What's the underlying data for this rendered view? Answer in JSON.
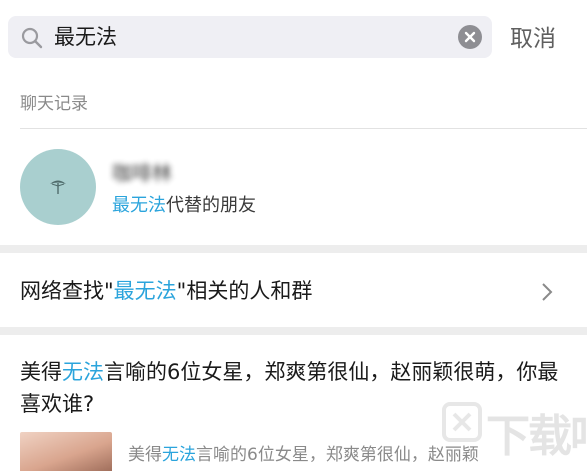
{
  "search": {
    "query": "最无法",
    "cancel_label": "取消"
  },
  "chat_records": {
    "section_label": "聊天记录",
    "result": {
      "contact_name": "咖啡林",
      "match_highlight": "最无法",
      "match_rest": "代替的朋友"
    }
  },
  "network_search": {
    "prefix": "网络查找\"",
    "keyword": "最无法",
    "suffix": "\"相关的人和群"
  },
  "article": {
    "title_prefix": "美得",
    "title_highlight": "无法",
    "title_rest": "言喻的6位女星，郑爽第很仙，赵丽颖很萌，你最喜欢谁?",
    "snippet_prefix": "美得",
    "snippet_highlight": "无法",
    "snippet_rest": "言喻的6位女星，郑爽第很仙，赵丽颖"
  },
  "watermark": {
    "text": "下载吧"
  },
  "colors": {
    "highlight": "#2ba4dc",
    "search_bg": "#efeff4",
    "avatar_bg": "#a9cfcf",
    "section_gap": "#ededed"
  },
  "icons": {
    "search": "search-icon",
    "clear": "clear-icon",
    "chevron": "chevron-right-icon"
  }
}
